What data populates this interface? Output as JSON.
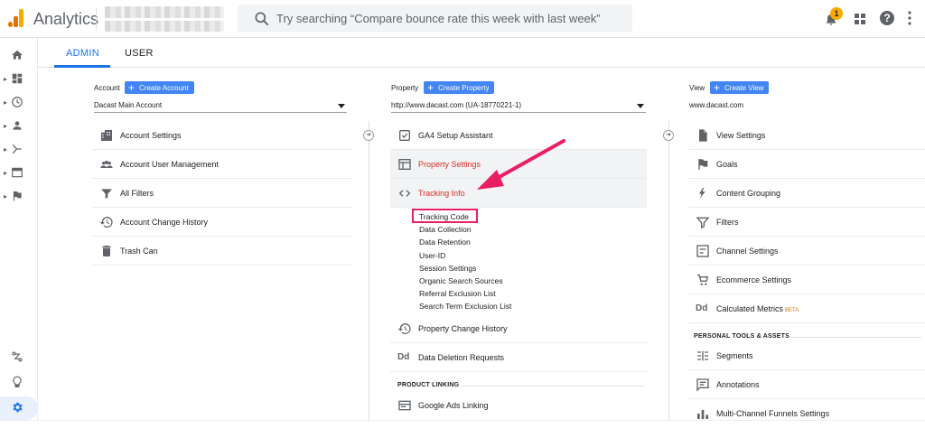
{
  "app": {
    "title": "Analytics"
  },
  "search": {
    "placeholder": "Try searching “Compare bounce rate this week with last week”"
  },
  "header": {
    "notification_count": "1",
    "help_label": "?"
  },
  "tabs": [
    {
      "label": "ADMIN",
      "active": true
    },
    {
      "label": "USER",
      "active": false
    }
  ],
  "account": {
    "header_label": "Account",
    "create_label": "Create Account",
    "selected": "Dacast Main Account",
    "items": [
      {
        "label": "Account Settings",
        "icon": "building-icon"
      },
      {
        "label": "Account User Management",
        "icon": "people-icon"
      },
      {
        "label": "All Filters",
        "icon": "filter-icon"
      },
      {
        "label": "Account Change History",
        "icon": "history-icon"
      },
      {
        "label": "Trash Can",
        "icon": "trash-icon"
      }
    ]
  },
  "property": {
    "header_label": "Property",
    "create_label": "Create Property",
    "selected": "http://www.dacast.com (UA-18770221-1)",
    "items": [
      {
        "label": "GA4 Setup Assistant",
        "icon": "checkbox-icon"
      },
      {
        "label": "Property Settings",
        "icon": "window-icon",
        "highlighted": true
      },
      {
        "label": "Tracking Info",
        "icon": "code-icon",
        "highlighted": true,
        "active": true
      },
      {
        "label": "Property Change History",
        "icon": "history-icon"
      },
      {
        "label": "Data Deletion Requests",
        "icon": "dd-icon"
      }
    ],
    "tracking_subitems": [
      "Tracking Code",
      "Data Collection",
      "Data Retention",
      "User-ID",
      "Session Settings",
      "Organic Search Sources",
      "Referral Exclusion List",
      "Search Term Exclusion List"
    ],
    "section_label": "PRODUCT LINKING",
    "linking_items": [
      {
        "label": "Google Ads Linking",
        "icon": "ads-icon"
      }
    ]
  },
  "view": {
    "header_label": "View",
    "create_label": "Create View",
    "selected": "www.dacast.com",
    "items": [
      {
        "label": "View Settings",
        "icon": "document-icon"
      },
      {
        "label": "Goals",
        "icon": "flag-icon"
      },
      {
        "label": "Content Grouping",
        "icon": "person-walk-icon"
      },
      {
        "label": "Filters",
        "icon": "filter-icon"
      },
      {
        "label": "Channel Settings",
        "icon": "channel-icon"
      },
      {
        "label": "Ecommerce Settings",
        "icon": "cart-icon"
      },
      {
        "label": "Calculated Metrics",
        "icon": "dd-icon",
        "badge": "BETA"
      }
    ],
    "section_label": "PERSONAL TOOLS & ASSETS",
    "tools_items": [
      {
        "label": "Segments",
        "icon": "segments-icon"
      },
      {
        "label": "Annotations",
        "icon": "comment-icon"
      },
      {
        "label": "Multi-Channel Funnels Settings",
        "icon": "bar-chart-icon"
      }
    ]
  },
  "colors": {
    "accent": "#1a73e8",
    "button": "#4285f4",
    "brand": "#f9ab00",
    "alert": "#d93025",
    "annotation": "#e91e63"
  }
}
